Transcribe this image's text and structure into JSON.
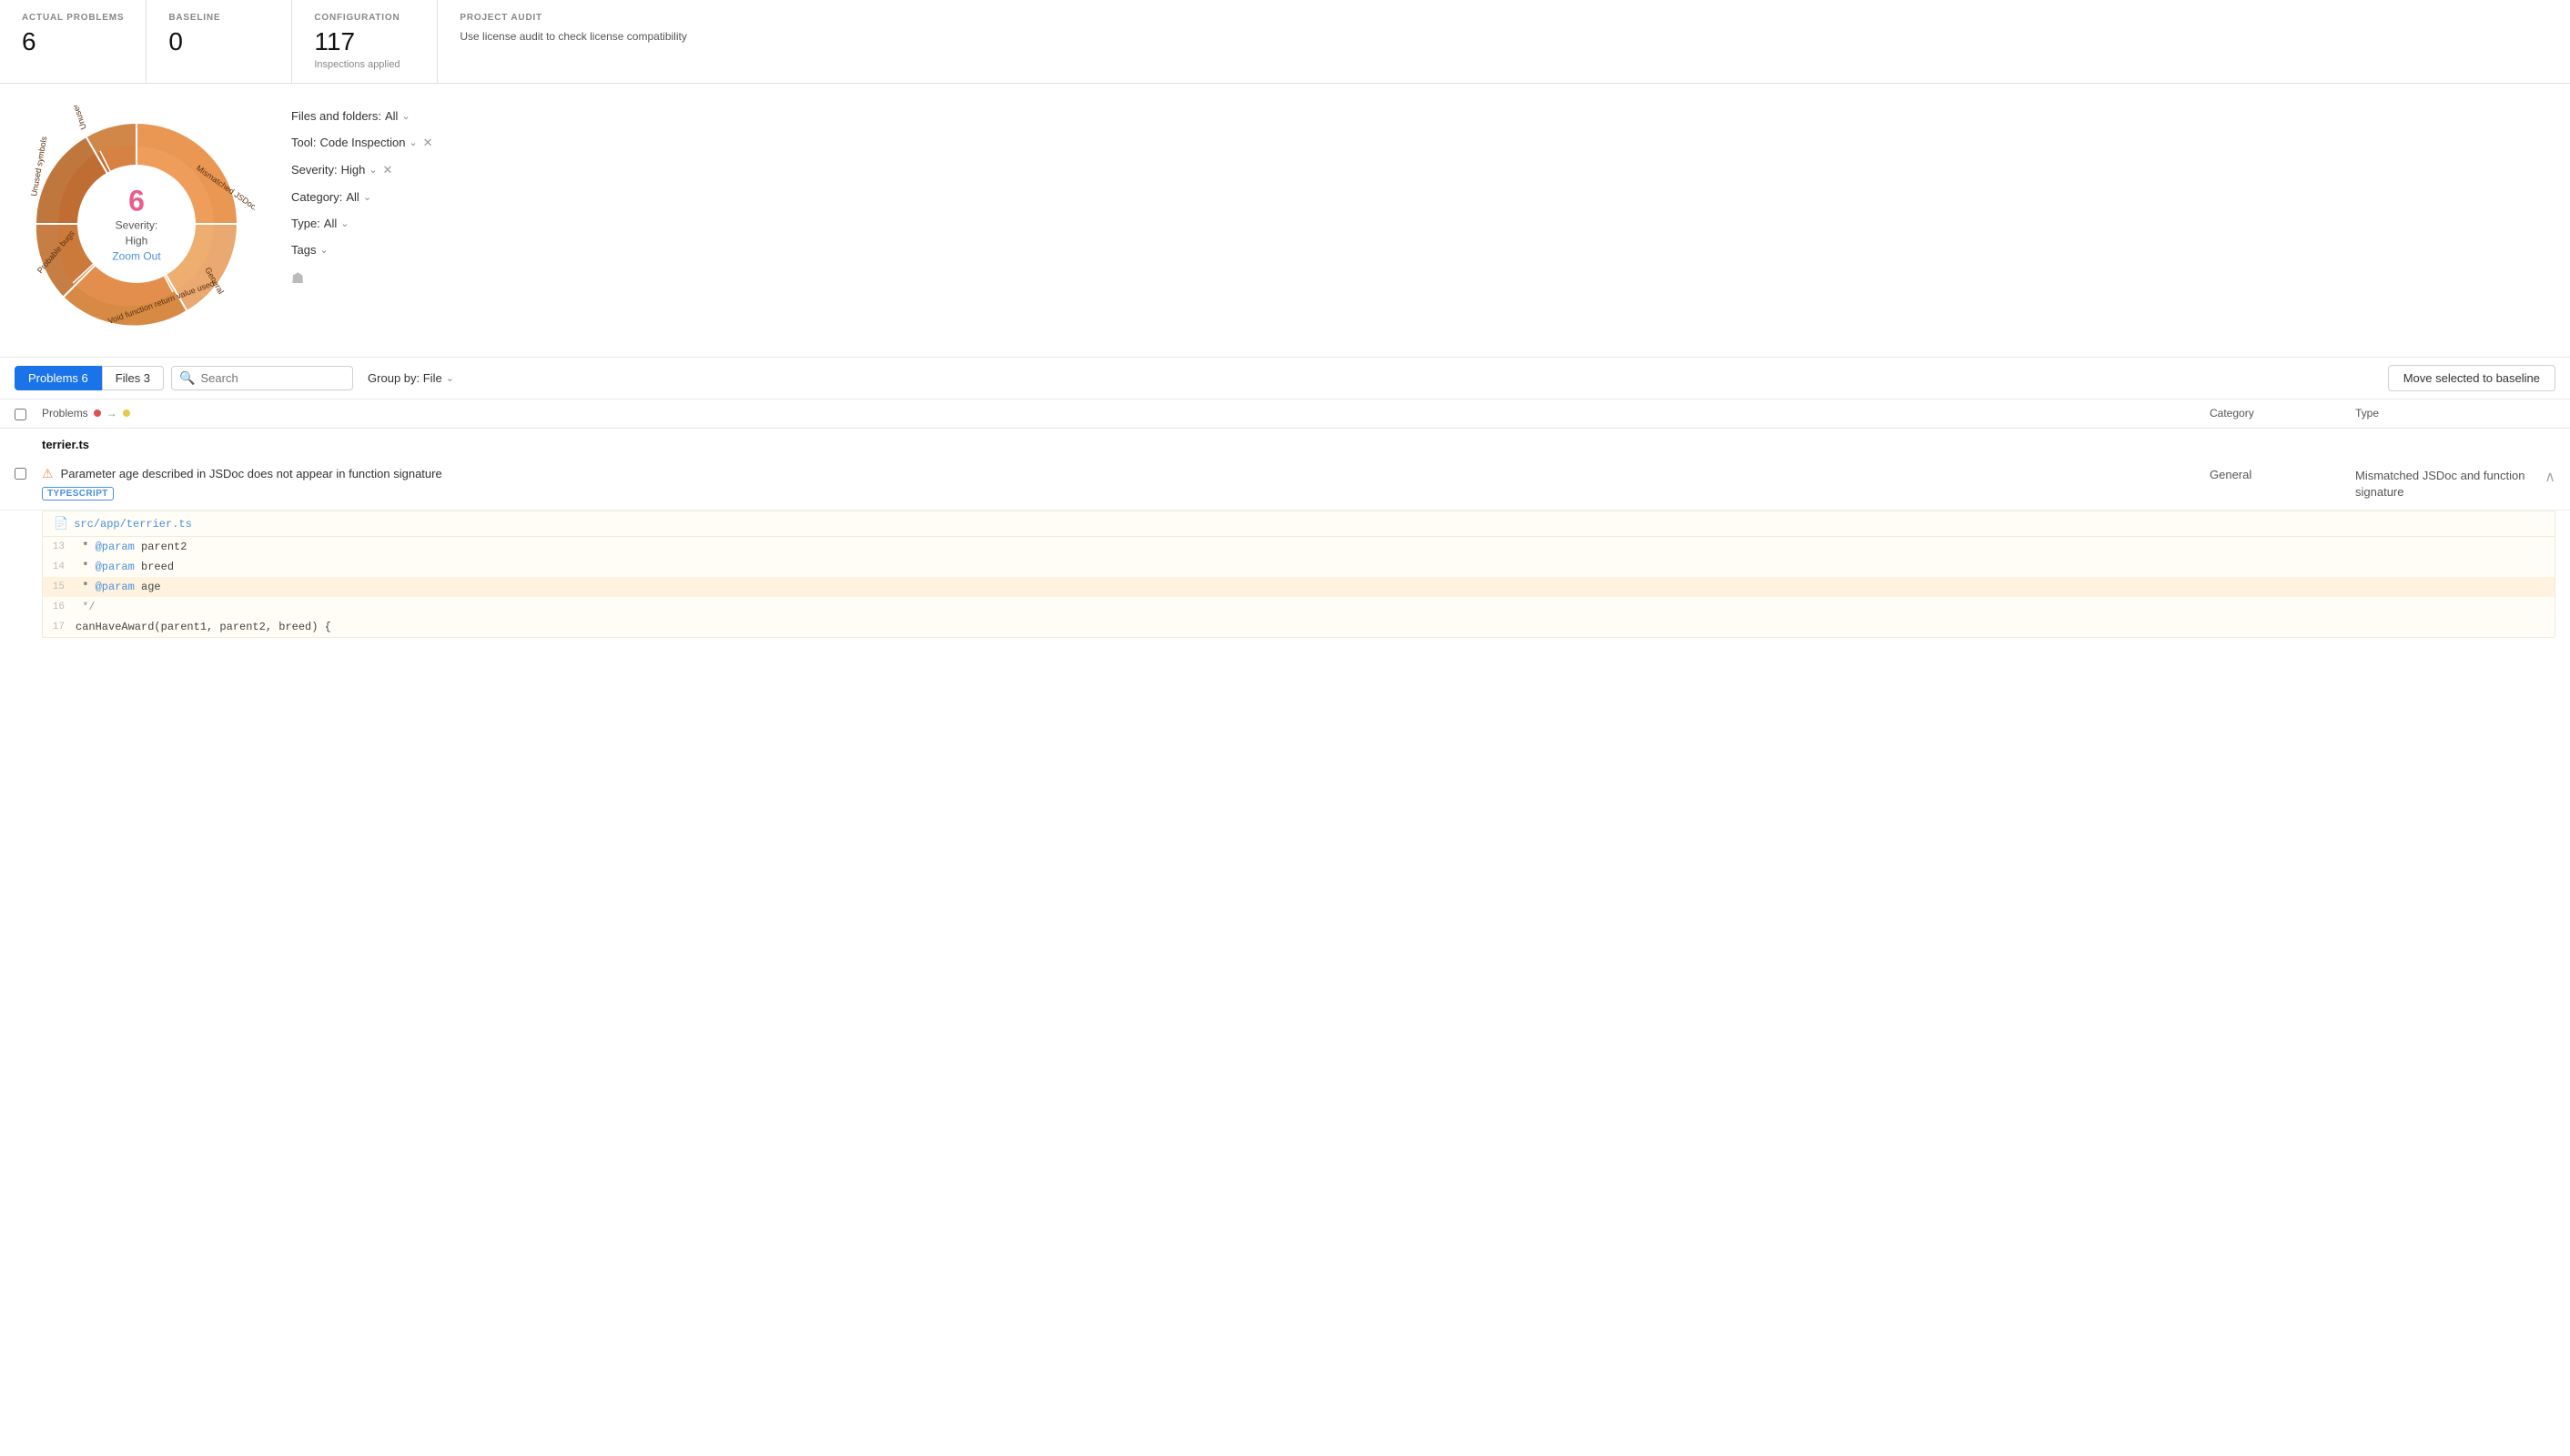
{
  "stats": {
    "actual_problems": {
      "label": "ACTUAL PROBLEMS",
      "value": "6"
    },
    "baseline": {
      "label": "BASELINE",
      "value": "0"
    },
    "configuration": {
      "label": "CONFIGURATION",
      "value": "117",
      "sub": "Inspections applied"
    },
    "project_audit": {
      "label": "PROJECT AUDIT",
      "value": "Use license audit to check license compatibility"
    }
  },
  "donut": {
    "center_number": "6",
    "center_label": "Severity:\nHigh",
    "zoom_label": "Zoom Out",
    "segments": [
      {
        "label": "Mismatched JSDoc...",
        "color": "#e8914a",
        "start": 0,
        "size": 72
      },
      {
        "label": "General",
        "color": "#e8a060",
        "start": 72,
        "size": 40
      },
      {
        "label": "Void function return value used",
        "color": "#d4843a",
        "start": 112,
        "size": 80
      },
      {
        "label": "Probable bugs",
        "color": "#c07030",
        "start": 192,
        "size": 60
      },
      {
        "label": "Unused symbols",
        "color": "#b86828",
        "start": 252,
        "size": 50
      },
      {
        "label": "Unused local symbol",
        "color": "#cc7a34",
        "start": 302,
        "size": 58
      }
    ]
  },
  "filters": [
    {
      "id": "files-folders",
      "label": "Files and folders:",
      "value": "All",
      "has_dropdown": true,
      "has_close": false
    },
    {
      "id": "tool",
      "label": "Tool:",
      "value": "Code Inspection",
      "has_dropdown": true,
      "has_close": true
    },
    {
      "id": "severity",
      "label": "Severity:",
      "value": "High",
      "has_dropdown": true,
      "has_close": true
    },
    {
      "id": "category",
      "label": "Category:",
      "value": "All",
      "has_dropdown": true,
      "has_close": false
    },
    {
      "id": "type",
      "label": "Type:",
      "value": "All",
      "has_dropdown": true,
      "has_close": false
    },
    {
      "id": "tags",
      "label": "Tags",
      "value": "",
      "has_dropdown": true,
      "has_close": false
    }
  ],
  "toolbar": {
    "tab_problems": "Problems 6",
    "tab_files": "Files 3",
    "search_placeholder": "Search",
    "group_by_label": "Group by: File",
    "move_baseline_label": "Move selected to baseline"
  },
  "table": {
    "col_problems": "Problems",
    "col_category": "Category",
    "col_type": "Type",
    "file_groups": [
      {
        "filename": "terrier.ts",
        "problems": [
          {
            "id": "p1",
            "title": "Parameter age described in JSDoc does not appear in function signature",
            "lang": "TYPESCRIPT",
            "category": "General",
            "type": "Mismatched JSDoc and function signature",
            "severity_icon": "warning",
            "code_file": "src/app/terrier.ts",
            "code_lines": [
              {
                "num": "13",
                "content": " * @param parent2",
                "highlighted": false
              },
              {
                "num": "14",
                "content": " * @param breed",
                "highlighted": false
              },
              {
                "num": "15",
                "content": " * @param age",
                "highlighted": true
              },
              {
                "num": "16",
                "content": " */",
                "highlighted": false
              },
              {
                "num": "17",
                "content": "canHaveAward(parent1, parent2, breed) {",
                "highlighted": false
              }
            ]
          }
        ]
      }
    ]
  }
}
